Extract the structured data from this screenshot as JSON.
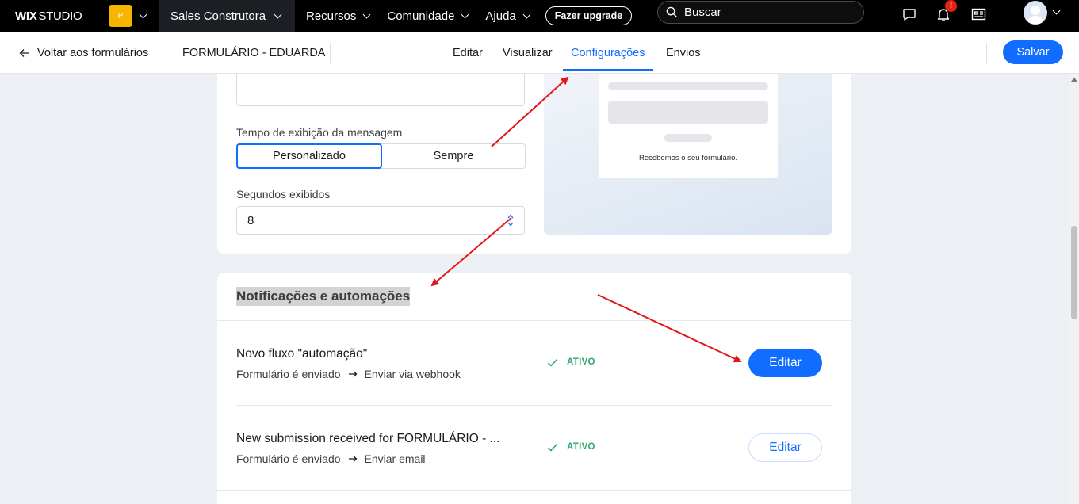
{
  "topbar": {
    "logo_bold": "WIX",
    "logo_light": "STUDIO",
    "site_initial": "P",
    "site_name": "Sales Construtora",
    "menus": [
      "Recursos",
      "Comunidade",
      "Ajuda"
    ],
    "upgrade": "Fazer upgrade",
    "search_placeholder": "Buscar",
    "notification_badge": "!"
  },
  "subbar": {
    "back": "Voltar aos formulários",
    "form_title": "FORMULÁRIO - EDUARDA",
    "tabs": [
      "Editar",
      "Visualizar",
      "Configurações",
      "Envios"
    ],
    "active_tab": "Configurações",
    "save": "Salvar"
  },
  "settings": {
    "display_time_label": "Tempo de exibição da mensagem",
    "options": [
      "Personalizado",
      "Sempre"
    ],
    "selected_option": "Personalizado",
    "seconds_label": "Segundos exibidos",
    "seconds_value": "8",
    "preview_message": "Recebemos o seu formulário."
  },
  "notifications": {
    "title": "Notificações e automações",
    "rows": [
      {
        "title": "Novo fluxo \"automação\"",
        "trigger": "Formulário é enviado",
        "action": "Enviar via webhook",
        "status": "ATIVO",
        "button": "Editar"
      },
      {
        "title": "New submission received for FORMULÁRIO - ...",
        "trigger": "Formulário é enviado",
        "action": "Enviar email",
        "status": "ATIVO",
        "button": "Editar"
      }
    ]
  },
  "colors": {
    "accent": "#116dff",
    "status": "#2fa86d",
    "annotation": "#e0181b"
  }
}
